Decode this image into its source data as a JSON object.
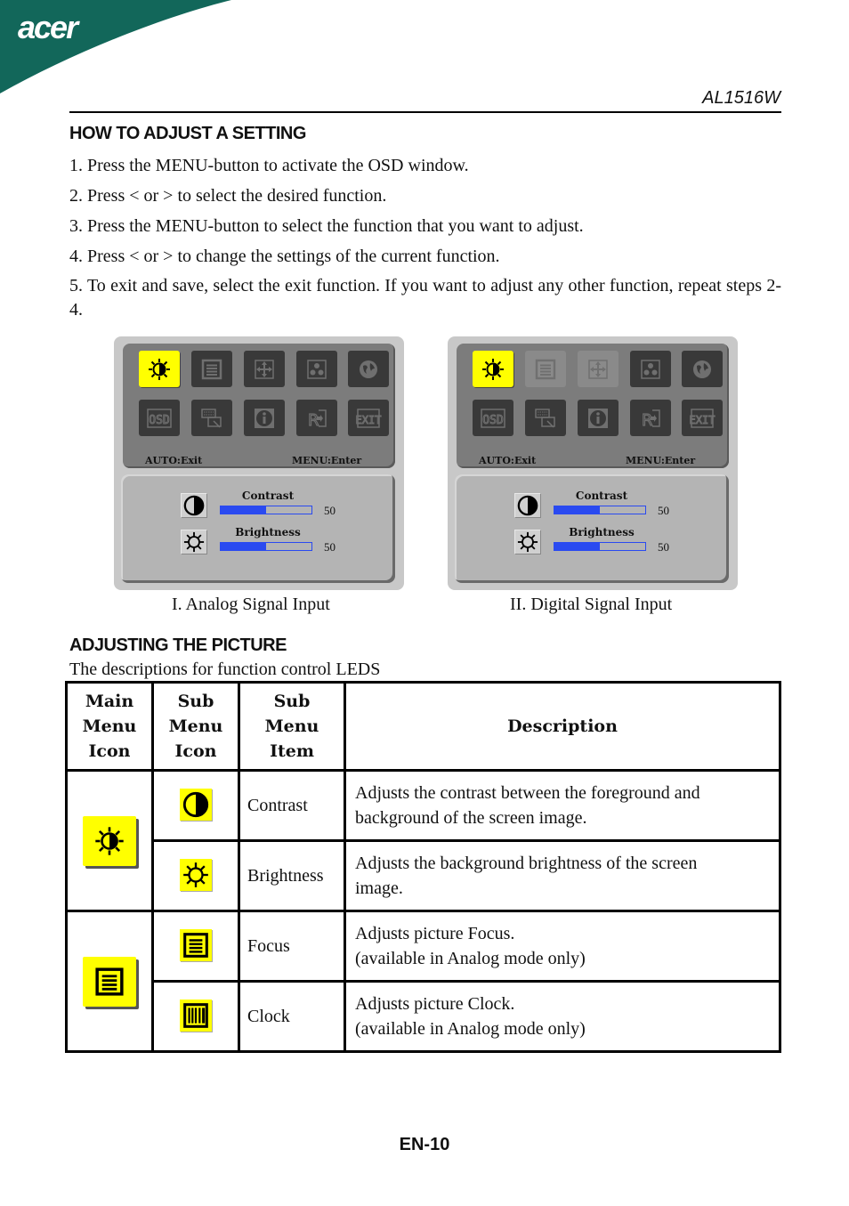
{
  "header": {
    "brand": "acer",
    "brand_color": "#12675a",
    "model": "AL1516W"
  },
  "section1": {
    "title": "HOW TO ADJUST A SETTING",
    "steps": [
      "1.  Press the MENU-button  to activate the OSD window.",
      "2.  Press < or  > to select the desired function.",
      "3.  Press the MENU-button  to select the function that you want to adjust.",
      "4.  Press < or  > to change the settings of the current function.",
      "5.  To exit and save, select the exit function. If you want to adjust any other function, repeat steps 2-4."
    ]
  },
  "osd_panels": [
    {
      "caption": "I. Analog Signal Input",
      "icons": [
        {
          "name": "picture",
          "state": "active"
        },
        {
          "name": "focus-clock",
          "state": "normal"
        },
        {
          "name": "position",
          "state": "normal"
        },
        {
          "name": "color",
          "state": "normal"
        },
        {
          "name": "language",
          "state": "normal"
        },
        {
          "name": "osd-settings",
          "state": "normal"
        },
        {
          "name": "auto-config",
          "state": "normal"
        },
        {
          "name": "information",
          "state": "normal"
        },
        {
          "name": "reset",
          "state": "normal"
        },
        {
          "name": "exit",
          "state": "normal"
        }
      ],
      "hint_left": "AUTO:Exit",
      "hint_right": "MENU:Enter",
      "settings": [
        {
          "label": "Contrast",
          "value": "50",
          "level": 0.5
        },
        {
          "label": "Brightness",
          "value": "50",
          "level": 0.5
        }
      ]
    },
    {
      "caption": "II. Digital Signal Input",
      "icons": [
        {
          "name": "picture",
          "state": "active"
        },
        {
          "name": "focus-clock",
          "state": "disabled"
        },
        {
          "name": "position",
          "state": "disabled"
        },
        {
          "name": "color",
          "state": "normal"
        },
        {
          "name": "language",
          "state": "normal"
        },
        {
          "name": "osd-settings",
          "state": "normal"
        },
        {
          "name": "auto-config",
          "state": "normal"
        },
        {
          "name": "information",
          "state": "normal"
        },
        {
          "name": "reset",
          "state": "normal"
        },
        {
          "name": "exit",
          "state": "normal"
        }
      ],
      "hint_left": "AUTO:Exit",
      "hint_right": "MENU:Enter",
      "settings": [
        {
          "label": "Contrast",
          "value": "50",
          "level": 0.5
        },
        {
          "label": "Brightness",
          "value": "50",
          "level": 0.5
        }
      ]
    }
  ],
  "section2": {
    "title": "ADJUSTING THE PICTURE",
    "subtitle": "The descriptions for function control LEDS",
    "table": {
      "headers": [
        "Main Menu Icon",
        "Sub Menu Icon",
        "Sub Menu Item",
        "Description"
      ],
      "groups": [
        {
          "main_icon": "picture-icon",
          "rows": [
            {
              "sub_icon": "contrast-icon",
              "item": "Contrast",
              "description": [
                "Adjusts the contrast between the foreground and",
                "background of the screen image."
              ]
            },
            {
              "sub_icon": "brightness-icon",
              "item": "Brightness",
              "description": [
                "Adjusts the background brightness of the screen",
                "image."
              ]
            }
          ]
        },
        {
          "main_icon": "focus-clock-icon",
          "rows": [
            {
              "sub_icon": "focus-icon",
              "item": "Focus",
              "description": [
                "Adjusts picture Focus.",
                "(available in Analog  mode only)"
              ]
            },
            {
              "sub_icon": "clock-icon",
              "item": "Clock",
              "description": [
                "Adjusts picture Clock.",
                "(available in Analog  mode only)"
              ]
            }
          ]
        }
      ]
    }
  },
  "footer": {
    "page": "EN-10"
  }
}
